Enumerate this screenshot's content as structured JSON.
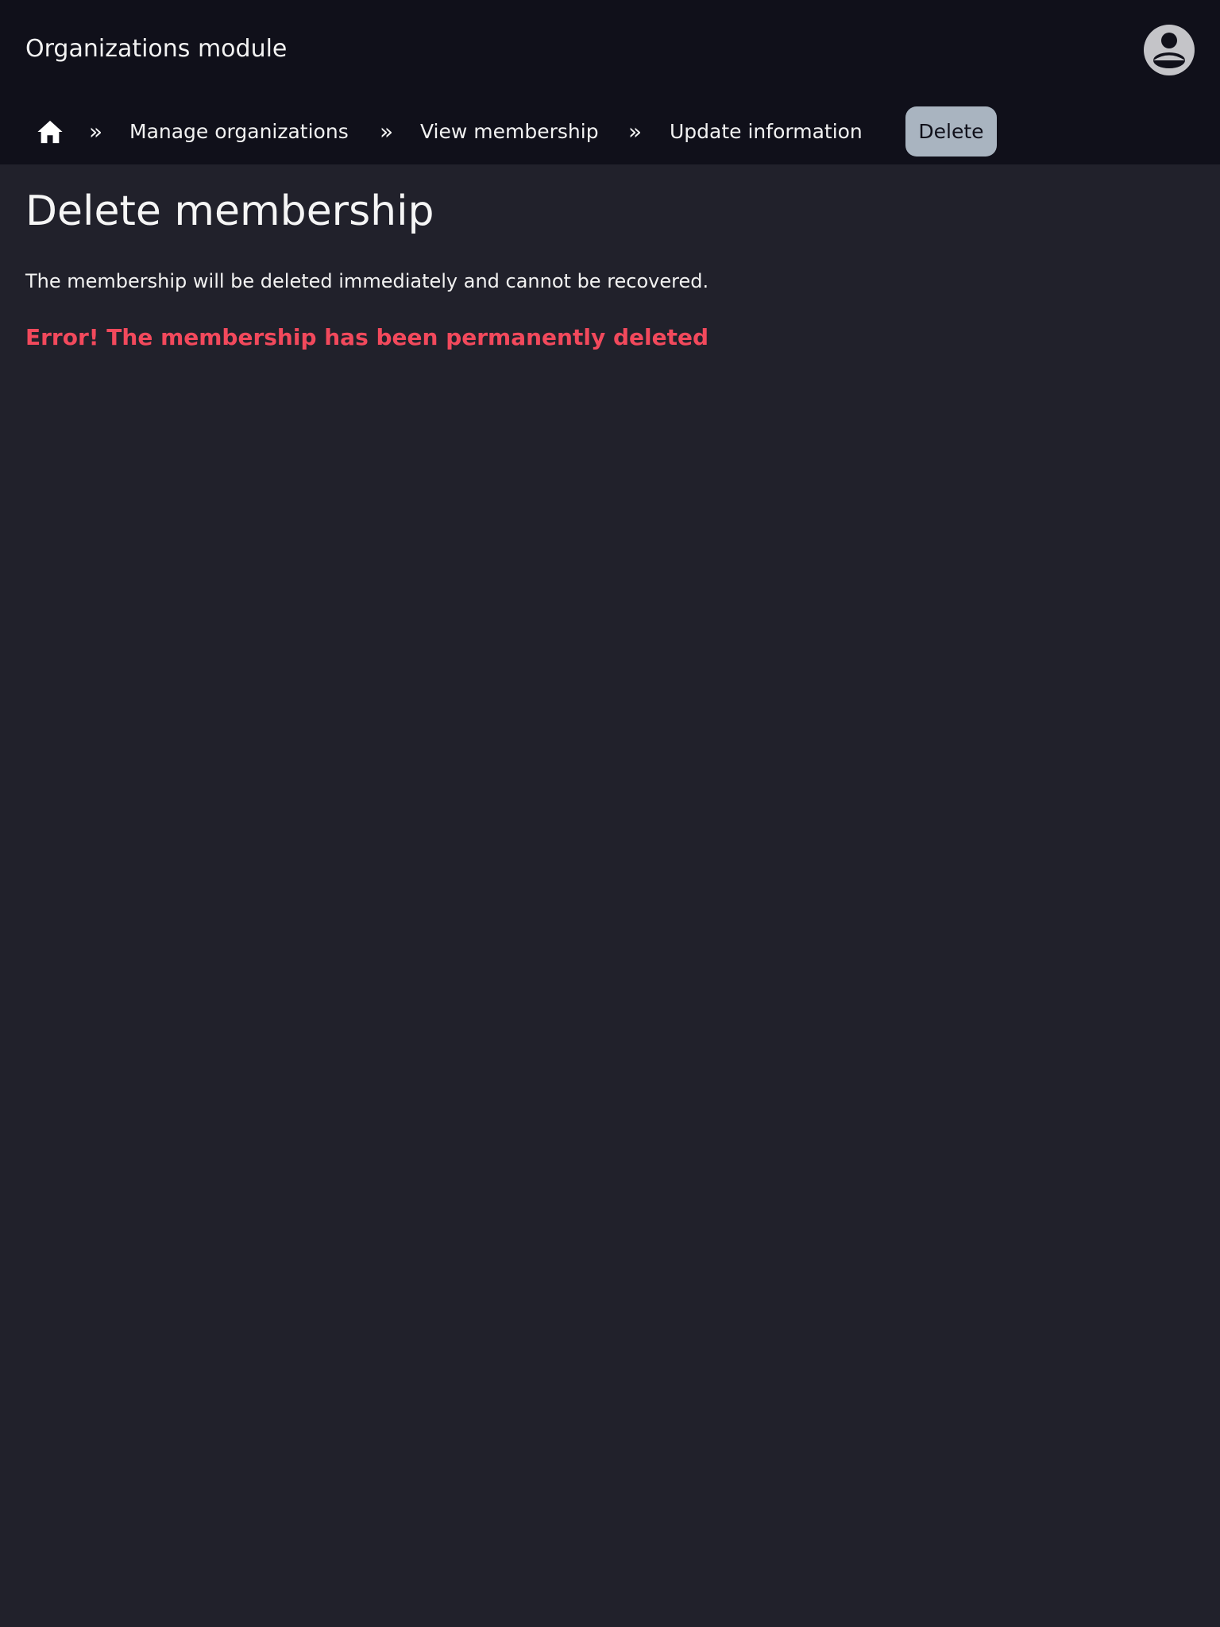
{
  "header": {
    "title": "Organizations module"
  },
  "breadcrumb": {
    "separator": "»",
    "items": [
      {
        "label": "Manage organizations"
      },
      {
        "label": "View membership"
      },
      {
        "label": "Update information"
      }
    ],
    "current": "Delete"
  },
  "main": {
    "title": "Delete membership",
    "description": "The membership will be deleted immediately and cannot be recovered.",
    "error": "Error! The membership has been permanently deleted"
  },
  "colors": {
    "header_bg": "#10101a",
    "page_bg": "#21212b",
    "error": "#f2495c",
    "active_crumb": "#a9b4c0"
  }
}
